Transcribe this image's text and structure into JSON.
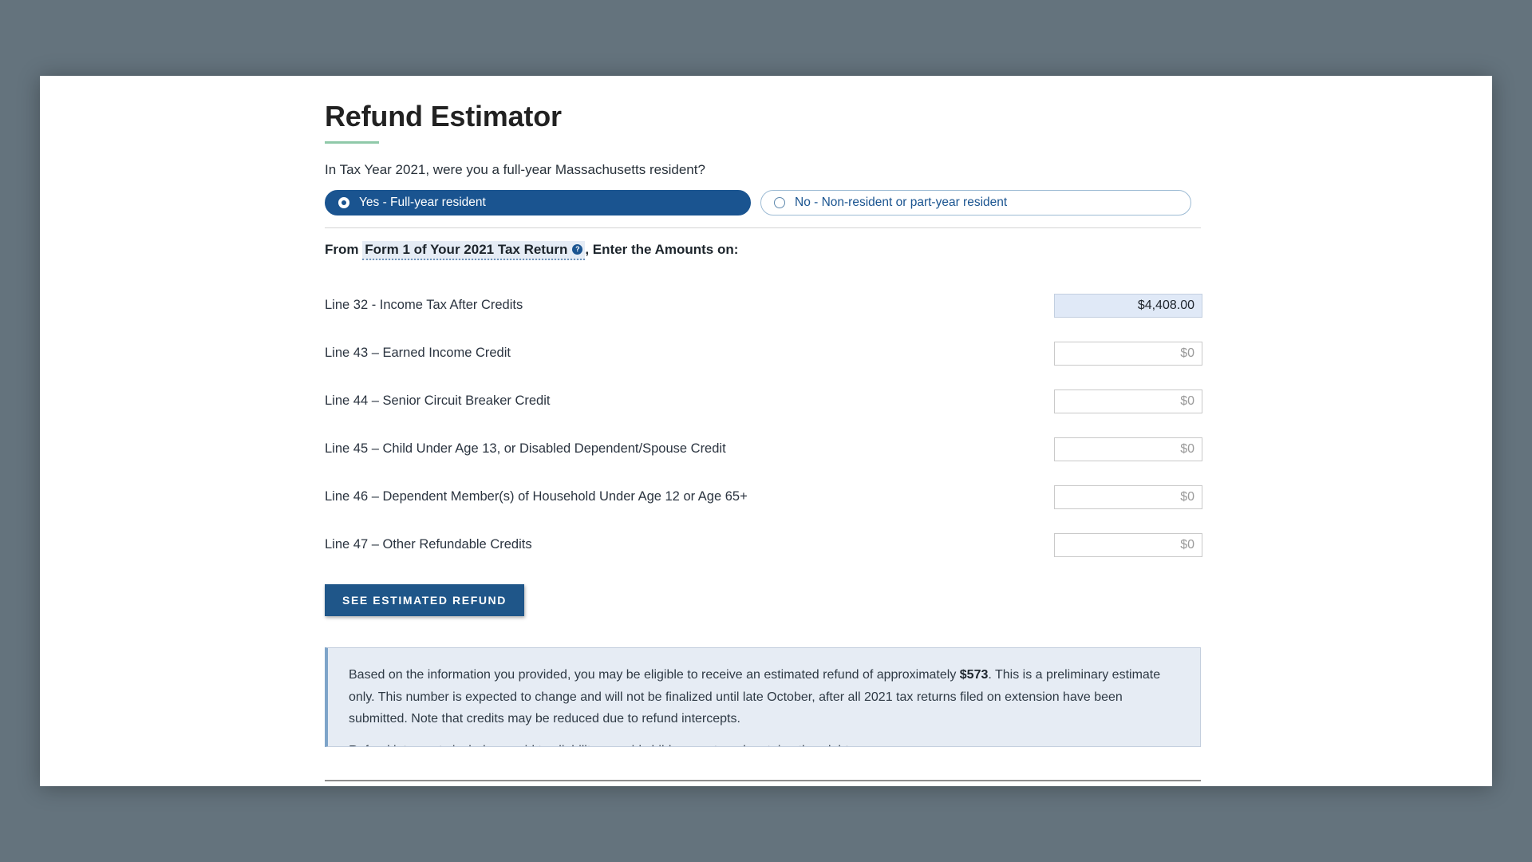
{
  "page": {
    "title": "Refund Estimator"
  },
  "residency": {
    "question": "In Tax Year 2021, were you a full-year Massachusetts resident?",
    "options": [
      {
        "label": "Yes - Full-year resident",
        "selected": true
      },
      {
        "label": "No - Non-resident or part-year resident",
        "selected": false
      }
    ]
  },
  "instruction": {
    "prefix": "From",
    "term": "Form 1 of Your 2021 Tax Return",
    "help_icon": "?",
    "suffix": ", Enter the Amounts on:"
  },
  "lines": [
    {
      "label": "Line 32 - Income Tax After Credits",
      "value": "$4,408.00",
      "placeholder": "$0",
      "filled": true
    },
    {
      "label": "Line 43 – Earned Income Credit",
      "value": "",
      "placeholder": "$0",
      "filled": false
    },
    {
      "label": "Line 44 – Senior Circuit Breaker Credit",
      "value": "",
      "placeholder": "$0",
      "filled": false
    },
    {
      "label": "Line 45 – Child Under Age 13, or Disabled Dependent/Spouse Credit",
      "value": "",
      "placeholder": "$0",
      "filled": false
    },
    {
      "label": "Line 46 – Dependent Member(s) of Household Under Age 12 or Age 65+",
      "value": "",
      "placeholder": "$0",
      "filled": false
    },
    {
      "label": "Line 47 – Other Refundable Credits",
      "value": "",
      "placeholder": "$0",
      "filled": false
    }
  ],
  "submit": {
    "label": "SEE ESTIMATED REFUND"
  },
  "result": {
    "text_before_amount": "Based on the information you provided, you may be eligible to receive an estimated refund of approximately ",
    "amount": "$573",
    "text_after_amount": ". This is a preliminary estimate only. This number is expected to change and will not be finalized until late October, after all 2021 tax returns filed on extension have been submitted. Note that credits may be reduced due to refund intercepts.",
    "clipped_note": "Refund intercepts include unpaid tax liability, unpaid child support, and certain other debts."
  },
  "colors": {
    "background": "#64737d",
    "brand_blue": "#1a5490",
    "button_blue": "#1f5689",
    "accent_green": "#8fc9a9",
    "panel_bg": "#e6ecf4",
    "panel_accent": "#7ea4c9",
    "filled_input_bg": "#e0e9f7"
  }
}
